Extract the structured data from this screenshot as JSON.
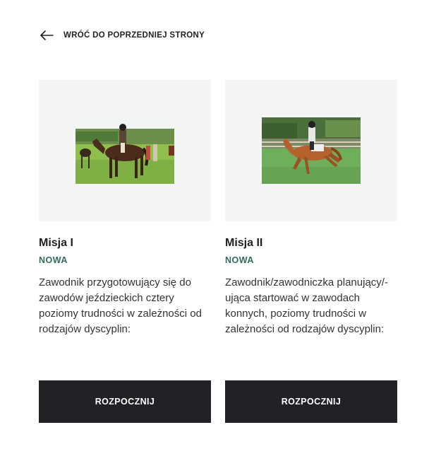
{
  "back": {
    "label": "WRÓĆ DO POPRZEDNIEJ STRONY",
    "icon": "arrow-left-icon"
  },
  "cards": [
    {
      "title": "Misja I",
      "badge": "NOWA",
      "description": "Zawodnik przygotowujący się do zawodów jeździeckich cztery poziomy trudności w zależności od rodzajów dyscyplin:",
      "button": "ROZPOCZNIJ"
    },
    {
      "title": "Misja II",
      "badge": "NOWA",
      "description": "Zawodnik/zawodniczka planujący/-ująca startować w zawodach konnych, poziomy trudności w zależności od rodzajów dyscyplin:",
      "button": "ROZPOCZNIJ"
    }
  ],
  "colors": {
    "badge": "#2e6b5e",
    "button_bg": "#222226",
    "media_bg": "#f5f5f5"
  }
}
